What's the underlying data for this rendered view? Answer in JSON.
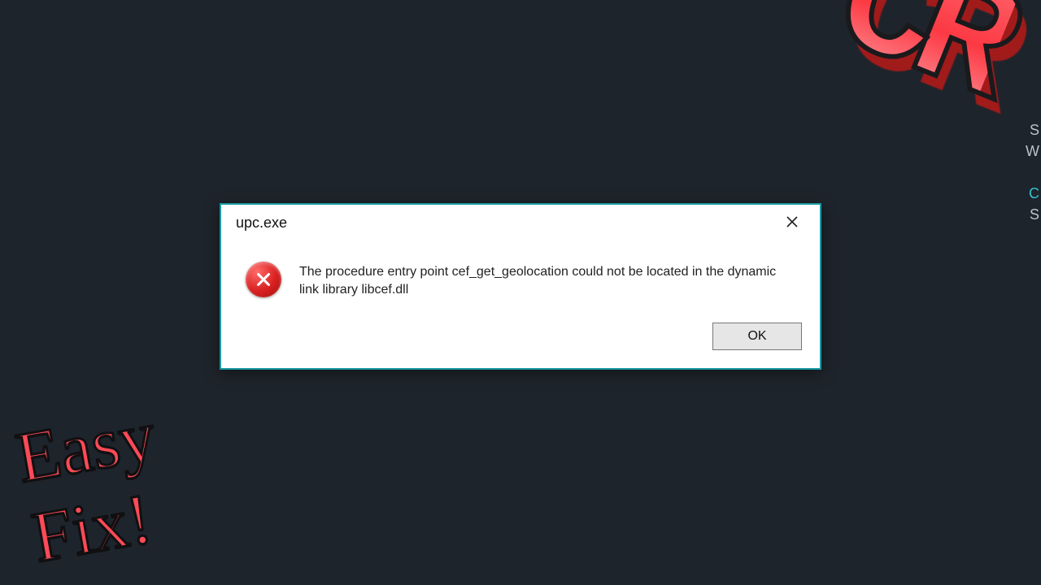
{
  "dialog": {
    "title": "upc.exe",
    "message": "The procedure entry point cef_get_geolocation could not be located in the dynamic link library libcef.dll",
    "ok_label": "OK"
  },
  "overlay": {
    "line1": "Easy",
    "line2": "Fix!",
    "logo_text": "CR"
  },
  "side_fragments": {
    "f1": "S",
    "f2": "W",
    "f3": "C",
    "f4": "S"
  },
  "colors": {
    "dialog_border": "#1a9aa3",
    "background": "#1e242b",
    "accent_red": "#ff4a57"
  }
}
